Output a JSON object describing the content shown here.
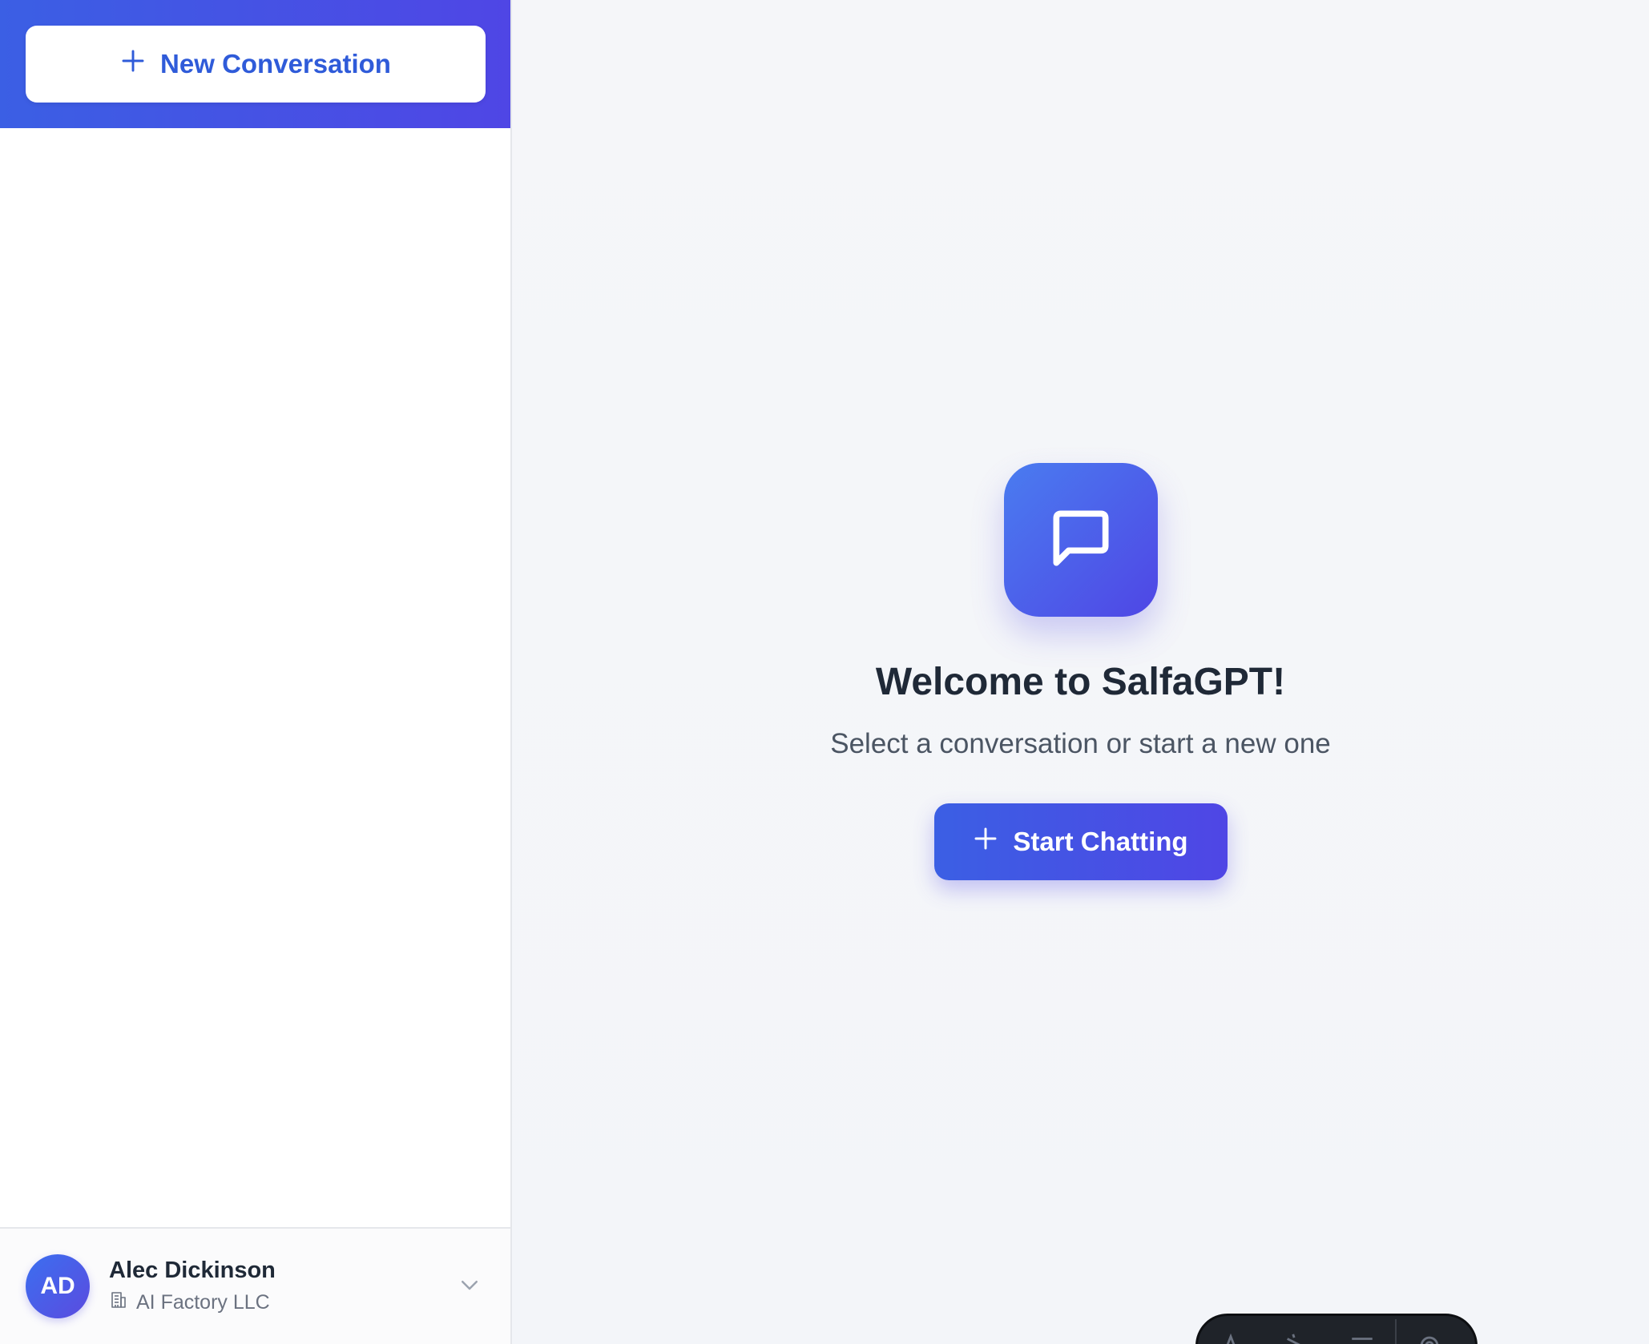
{
  "sidebar": {
    "new_conversation_label": "New Conversation",
    "user": {
      "initials": "AD",
      "name": "Alec Dickinson",
      "organization": "AI Factory LLC"
    }
  },
  "main": {
    "welcome_title": "Welcome to SalfaGPT!",
    "welcome_subtitle": "Select a conversation or start a new one",
    "start_button_label": "Start Chatting"
  },
  "dock": {
    "items": [
      "text-icon",
      "draw-icon",
      "menu-icon",
      "settings-icon"
    ]
  },
  "colors": {
    "accent": "#4f46e5",
    "accent_blue": "#3b5fe4",
    "button_text_blue": "#2f5bd9",
    "title_text": "#1f2937",
    "muted_text": "#6b7280"
  }
}
